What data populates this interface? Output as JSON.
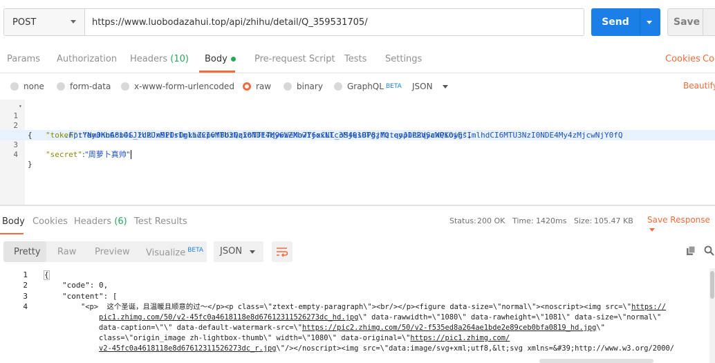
{
  "request": {
    "method": "POST",
    "url": "https://www.luobodazahui.top/api/zhihu/detail/Q_359531705/",
    "send_label": "Send",
    "save_label": "Save"
  },
  "request_tabs": {
    "params": "Params",
    "authorization": "Authorization",
    "headers": "Headers",
    "headers_count": "(10)",
    "body": "Body",
    "pre_request": "Pre-request Script",
    "tests": "Tests",
    "settings": "Settings",
    "cookies": "Cookies",
    "code_partial": "Coc"
  },
  "body_types": {
    "none": "none",
    "form_data": "form-data",
    "urlencoded": "x-www-form-urlencoded",
    "raw": "raw",
    "binary": "binary",
    "graphql": "GraphQL",
    "beta": "BETA",
    "format": "JSON",
    "beautify": "Beautify"
  },
  "editor": {
    "line_numbers": [
      "1",
      "2",
      "3",
      "4"
    ],
    "l1": "{",
    "l2_key": "\"token\"",
    "l2_val": "\"eyJhbGciOiJIUzUxMiIsImlhdCI6MTU3NzI0NDE4MywiZXhwIjoxNTc3MjQ1OTgzfQ.eyJ1c2VyaWQiOjEsImlhdCI6MTU3NzI0NDE4My4zMjcwNjY0fQ",
    "l2_cont": ".FptYNm0KnA8b4G_zcRJn9POrOgkiZxpvfBbzQqxoTTt7q96WeMo7Y6xCLL_oS4ksBP8jMztqopDRRqScXPKowg\"",
    "l3_key": "\"secret\"",
    "l3_val": "\"周萝卜真帅\"",
    "l4": "}"
  },
  "response_tabs": {
    "body": "Body",
    "cookies": "Cookies",
    "headers": "Headers",
    "headers_count": "(6)",
    "test_results": "Test Results"
  },
  "response_status": {
    "status_label": "Status:",
    "status_value": "200 OK",
    "time_label": "Time:",
    "time_value": "1420ms",
    "size_label": "Size:",
    "size_value": "105.47 KB",
    "save_response": "Save Response"
  },
  "view_modes": {
    "pretty": "Pretty",
    "raw": "Raw",
    "preview": "Preview",
    "visualize": "Visualize",
    "beta": "BETA",
    "format": "JSON"
  },
  "response_code": {
    "line_numbers": [
      "1",
      "2",
      "3",
      "4"
    ],
    "r1": "{",
    "r2_key": "\"code\"",
    "r2_val": "0,",
    "r3_key": "\"content\"",
    "r3_val": "[",
    "r4a": "\"<p>  这个圣诞，且温暖且顺意的过～</p><p class=\\\"ztext-empty-paragraph\\\"><br/></p><figure data-size=\\\"normal\\\"><noscript><img src=\\\"",
    "r4a_link": "https://",
    "r4b_link": "pic1.zhimg.com/50/v2-45fc0a4618118e8d67612311526273dc_hd.jpg",
    "r4b": "\\\" data-rawwidth=\\\"1080\\\" data-rawheight=\\\"1081\\\" data-size=\\\"normal\\\"",
    "r4c": "data-caption=\\\"\\\" data-default-watermark-src=\\\"",
    "r4c_link": "https://pic2.zhimg.com/50/v2-f535ed8a264ae1bde2e89ceb0bfa0819_hd.jpg",
    "r4c_end": "\\\"",
    "r4d": "class=\\\"origin_image zh-lightbox-thumb\\\" width=\\\"1080\\\" data-original=\\\"",
    "r4d_link": "https://pic1.zhimg.com/",
    "r4e_link": "v2-45fc0a4618118e8d67612311526273dc_r.jpg",
    "r4e": "\\\"/></noscript><img src=\\\"data:image/svg+xml;utf8,&lt;svg xmlns=&#39;http://www.w3.org/2000/"
  }
}
